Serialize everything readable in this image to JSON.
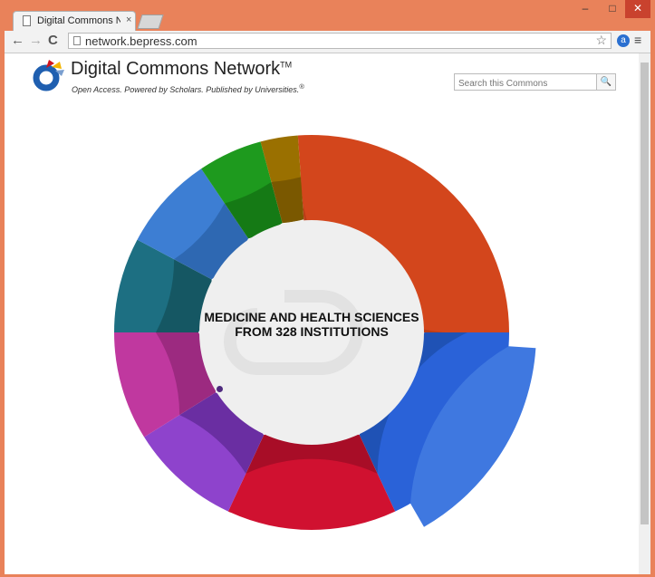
{
  "browser": {
    "tab_title": "Digital Commons Networ",
    "tab_close": "×",
    "url": "network.bepress.com",
    "window_controls": {
      "minimize": "–",
      "maximize": "□",
      "close": "✕"
    },
    "back_icon": "←",
    "forward_icon": "→",
    "reload_icon": "C",
    "star_icon": "☆",
    "ext_icon": "a",
    "menu_icon": "≡"
  },
  "site": {
    "title": "Digital Commons Network",
    "title_mark": "TM",
    "tagline": "Open Access. Powered by Scholars. Published by Universities.",
    "tagline_mark": "®",
    "search_placeholder": "Search this Commons",
    "search_icon": "🔍"
  },
  "sunburst": {
    "center_line1": "MEDICINE AND HEALTH SCIENCES",
    "center_line2": "FROM 328 INSTITUTIONS",
    "segments": [
      {
        "name": "orange",
        "start": -4,
        "end": 90,
        "color": "#d3461c",
        "inner": "#b93d17"
      },
      {
        "name": "blue",
        "start": 90,
        "end": 155,
        "color": "#2a62d8",
        "inner": "#1f52b5"
      },
      {
        "name": "red",
        "start": 155,
        "end": 205,
        "color": "#d01130",
        "inner": "#a80d27"
      },
      {
        "name": "purple",
        "start": 205,
        "end": 238,
        "color": "#8e43cc",
        "inner": "#6a2ea2"
      },
      {
        "name": "magenta",
        "start": 238,
        "end": 270,
        "color": "#c0389f",
        "inner": "#9c2a80"
      },
      {
        "name": "teal",
        "start": 270,
        "end": 298,
        "color": "#1d6f82",
        "inner": "#155763"
      },
      {
        "name": "steel-blue",
        "start": 298,
        "end": 326,
        "color": "#3d7ed3",
        "inner": "#2e68b2"
      },
      {
        "name": "green",
        "start": 326,
        "end": 345,
        "color": "#1e9a1e",
        "inner": "#157a15"
      },
      {
        "name": "olive",
        "start": 345,
        "end": 356,
        "color": "#9a7000",
        "inner": "#7a5800"
      }
    ]
  }
}
